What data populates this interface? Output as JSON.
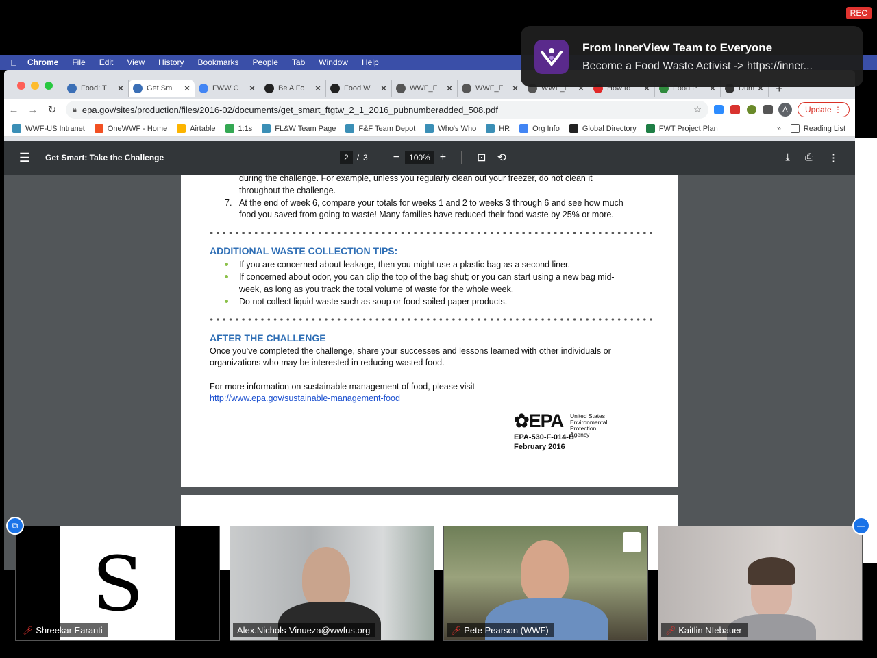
{
  "rec_badge": "REC",
  "notification": {
    "title": "From InnerView Team to Everyone",
    "message": "Become a Food Waste Activist -> https://inner..."
  },
  "menubar": {
    "items": [
      "Chrome",
      "File",
      "Edit",
      "View",
      "History",
      "Bookmarks",
      "People",
      "Tab",
      "Window",
      "Help"
    ]
  },
  "tabs": [
    {
      "label": "Food: T",
      "icon": "wwf-globe-icon",
      "color": "#3b6fb6",
      "active": false
    },
    {
      "label": "Get Sm",
      "icon": "wwf-globe-icon",
      "color": "#3b6fb6",
      "active": true
    },
    {
      "label": "FWW C",
      "icon": "google-docs-icon",
      "color": "#4285f4",
      "active": false
    },
    {
      "label": "Be A Fo",
      "icon": "panda-icon",
      "color": "#222222",
      "active": false
    },
    {
      "label": "Food W",
      "icon": "panda-icon",
      "color": "#222222",
      "active": false
    },
    {
      "label": "WWF_F",
      "icon": "globe-icon",
      "color": "#555555",
      "active": false
    },
    {
      "label": "WWF_F",
      "icon": "globe-icon",
      "color": "#555555",
      "active": false
    },
    {
      "label": "WWF_F",
      "icon": "globe-icon",
      "color": "#555555",
      "active": false
    },
    {
      "label": "How to",
      "icon": "flipboard-icon",
      "color": "#e12828",
      "active": false
    },
    {
      "label": "Food P",
      "icon": "flag-icon",
      "color": "#2f8a3c",
      "active": false
    },
    {
      "label": "Dumpe",
      "icon": "c-icon",
      "color": "#333333",
      "active": false
    }
  ],
  "toolbar": {
    "url": "epa.gov/sites/production/files/2016-02/documents/get_smart_ftgtw_2_1_2016_pubnumberadded_508.pdf",
    "avatar": "A",
    "update_label": "Update"
  },
  "bookmarks": [
    {
      "label": "WWF-US Intranet",
      "color": "#3b8fb6"
    },
    {
      "label": "OneWWF - Home",
      "color": "#f25022"
    },
    {
      "label": "Airtable",
      "color": "#fcb400"
    },
    {
      "label": "1:1s",
      "color": "#34a853"
    },
    {
      "label": "FL&W Team Page",
      "color": "#3b8fb6"
    },
    {
      "label": "F&F Team Depot",
      "color": "#3b8fb6"
    },
    {
      "label": "Who's Who",
      "color": "#3b8fb6"
    },
    {
      "label": "HR",
      "color": "#3b8fb6"
    },
    {
      "label": "Org Info",
      "color": "#4285f4"
    },
    {
      "label": "Global Directory",
      "color": "#222222"
    },
    {
      "label": "FWT Project Plan",
      "color": "#1e7e45"
    }
  ],
  "bookmarks_more": "»",
  "reading_list": "Reading List",
  "pdf": {
    "title": "Get Smart: Take the Challenge",
    "page_current": "2",
    "page_total": "3",
    "page_sep": "/",
    "zoom": "100%",
    "lines_top": [
      "during the challenge. For example, unless you regularly clean out your freezer, do not clean it",
      "throughout the challenge."
    ],
    "item7_num": "7.",
    "item7_lines": [
      "At the end of week 6, compare your totals for weeks 1 and 2 to weeks 3 through 6 and see how much",
      "food you saved from going to waste! Many families have reduced their food waste by 25% or more."
    ],
    "tips_heading": "ADDITIONAL WASTE COLLECTION TIPS:",
    "tips": [
      "If you are concerned about leakage, then you might use a plastic bag as a second liner.",
      "If concerned about odor, you can clip the top of the bag shut; or you can start using a new bag mid-",
      "week, as long as you track the total volume of waste for the whole week.",
      "Do not collect liquid waste such as soup or food-soiled paper products."
    ],
    "after_heading": "AFTER THE CHALLENGE",
    "after_lines": [
      "Once you’ve completed the challenge, share your successes and lessons learned with other individuals or",
      "organizations who may be interested in reducing wasted food."
    ],
    "more_info": "For more information on sustainable management of food, please visit",
    "link": "http://www.epa.gov/sustainable-management-food",
    "epa_logo": "EPA",
    "epa_agency": [
      "United States",
      "Environmental Protection",
      "Agency"
    ],
    "epa_code": "EPA-530-F-014-B",
    "epa_date": "February 2016"
  },
  "participants": [
    {
      "name": "Shreekar Earanti",
      "muted": true,
      "avatar_letter": "S"
    },
    {
      "name": "Alex.Nichols-Vinueza@wwfus.org",
      "muted": false
    },
    {
      "name": "Pete Pearson (WWF)",
      "muted": true
    },
    {
      "name": "Kaitlin NIebauer",
      "muted": true
    }
  ]
}
